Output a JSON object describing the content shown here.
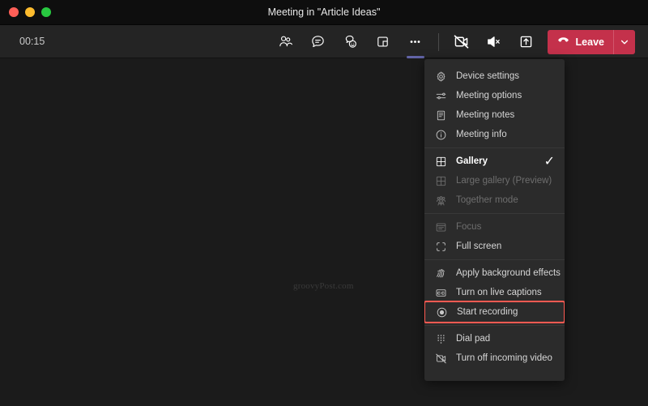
{
  "window": {
    "title": "Meeting in \"Article Ideas\"",
    "traffic_lights": [
      "close",
      "minimize",
      "maximize"
    ],
    "colors": {
      "close": "#ff5f57",
      "minimize": "#febc2e",
      "maximize": "#28c840",
      "titlebar_bg": "#0e0e0e",
      "toolbar_bg": "#242424",
      "stage_bg": "#1b1b1b",
      "menu_bg": "#2b2b2b",
      "accent": "#6264a7",
      "leave_red": "#c4314b",
      "highlight_red": "#ff5a52"
    }
  },
  "toolbar": {
    "timer": "00:15",
    "buttons": [
      {
        "name": "people-icon",
        "label": "Show participants",
        "active": false
      },
      {
        "name": "chat-icon",
        "label": "Show conversation",
        "active": false
      },
      {
        "name": "reactions-icon",
        "label": "Reactions",
        "active": false
      },
      {
        "name": "breakout-rooms-icon",
        "label": "Breakout rooms",
        "active": false
      },
      {
        "name": "more-options-icon",
        "label": "More actions",
        "active": true
      },
      {
        "name": "camera-off-icon",
        "label": "Turn camera on",
        "active": false
      },
      {
        "name": "speaker-mute-icon",
        "label": "Unmute",
        "active": false
      },
      {
        "name": "share-screen-icon",
        "label": "Share content",
        "active": false
      }
    ],
    "leave": {
      "label": "Leave",
      "icon": "hangup-icon",
      "chevron": "chevron-down-icon"
    }
  },
  "stage": {
    "watermark": "groovyPost.com"
  },
  "menu": {
    "groups": [
      {
        "items": [
          {
            "label": "Device settings",
            "icon": "gear-icon",
            "disabled": false,
            "checked": false,
            "highlighted": false
          },
          {
            "label": "Meeting options",
            "icon": "sliders-icon",
            "disabled": false,
            "checked": false,
            "highlighted": false
          },
          {
            "label": "Meeting notes",
            "icon": "notes-icon",
            "disabled": false,
            "checked": false,
            "highlighted": false
          },
          {
            "label": "Meeting info",
            "icon": "info-icon",
            "disabled": false,
            "checked": false,
            "highlighted": false
          }
        ]
      },
      {
        "items": [
          {
            "label": "Gallery",
            "icon": "grid-icon",
            "disabled": false,
            "checked": true,
            "highlighted": false
          },
          {
            "label": "Large gallery (Preview)",
            "icon": "grid-icon",
            "disabled": true,
            "checked": false,
            "highlighted": false
          },
          {
            "label": "Together mode",
            "icon": "together-icon",
            "disabled": true,
            "checked": false,
            "highlighted": false
          }
        ]
      },
      {
        "items": [
          {
            "label": "Focus",
            "icon": "focus-icon",
            "disabled": true,
            "checked": false,
            "highlighted": false
          },
          {
            "label": "Full screen",
            "icon": "fullscreen-icon",
            "disabled": false,
            "checked": false,
            "highlighted": false
          }
        ]
      },
      {
        "items": [
          {
            "label": "Apply background effects",
            "icon": "background-effects-icon",
            "disabled": false,
            "checked": false,
            "highlighted": false
          },
          {
            "label": "Turn on live captions",
            "icon": "closed-captions-icon",
            "disabled": false,
            "checked": false,
            "highlighted": false
          },
          {
            "label": "Start recording",
            "icon": "record-icon",
            "disabled": false,
            "checked": false,
            "highlighted": true
          }
        ]
      },
      {
        "items": [
          {
            "label": "Dial pad",
            "icon": "dialpad-icon",
            "disabled": false,
            "checked": false,
            "highlighted": false
          },
          {
            "label": "Turn off incoming video",
            "icon": "video-off-icon",
            "disabled": false,
            "checked": false,
            "highlighted": false
          }
        ]
      }
    ],
    "check_glyph": "✓"
  }
}
